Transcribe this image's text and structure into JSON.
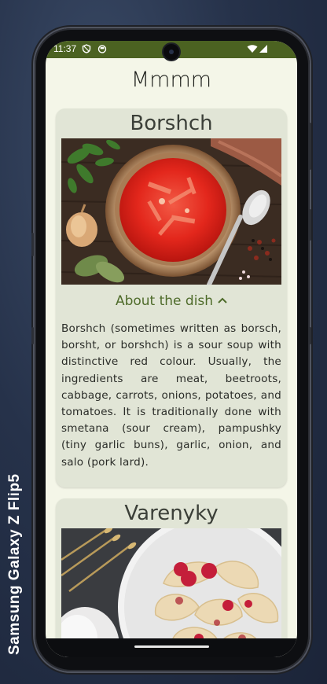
{
  "device": {
    "label": "Samsung Galaxy Z Flip5"
  },
  "status_bar": {
    "time": "11:37",
    "bg_color": "#4b6221",
    "icons": [
      "shield-icon",
      "circle-app-icon",
      "wifi-icon",
      "signal-icon"
    ]
  },
  "app": {
    "title": "Mmmm",
    "bg_color": "#f4f6e8",
    "card_color": "#e1e5d6",
    "accent_color": "#4e6b2a"
  },
  "dishes": [
    {
      "name": "Borshch",
      "image": "bowl-of-borshch-photo",
      "toggle_label": "About the dish",
      "toggle_icon": "chevron-up-icon",
      "description": "Borshch (sometimes written as borsch, borsht, or borshch) is a sour soup with distinctive red colour. Usually, the ingredients are meat, beetroots, cabbage, carrots, onions, potatoes, and tomatoes. It is traditionally done with smetana (sour cream), pampushky (tiny garlic buns), garlic, onion, and salo (pork lard)."
    },
    {
      "name": "Varenyky",
      "image": "plate-of-varenyky-photo"
    }
  ]
}
